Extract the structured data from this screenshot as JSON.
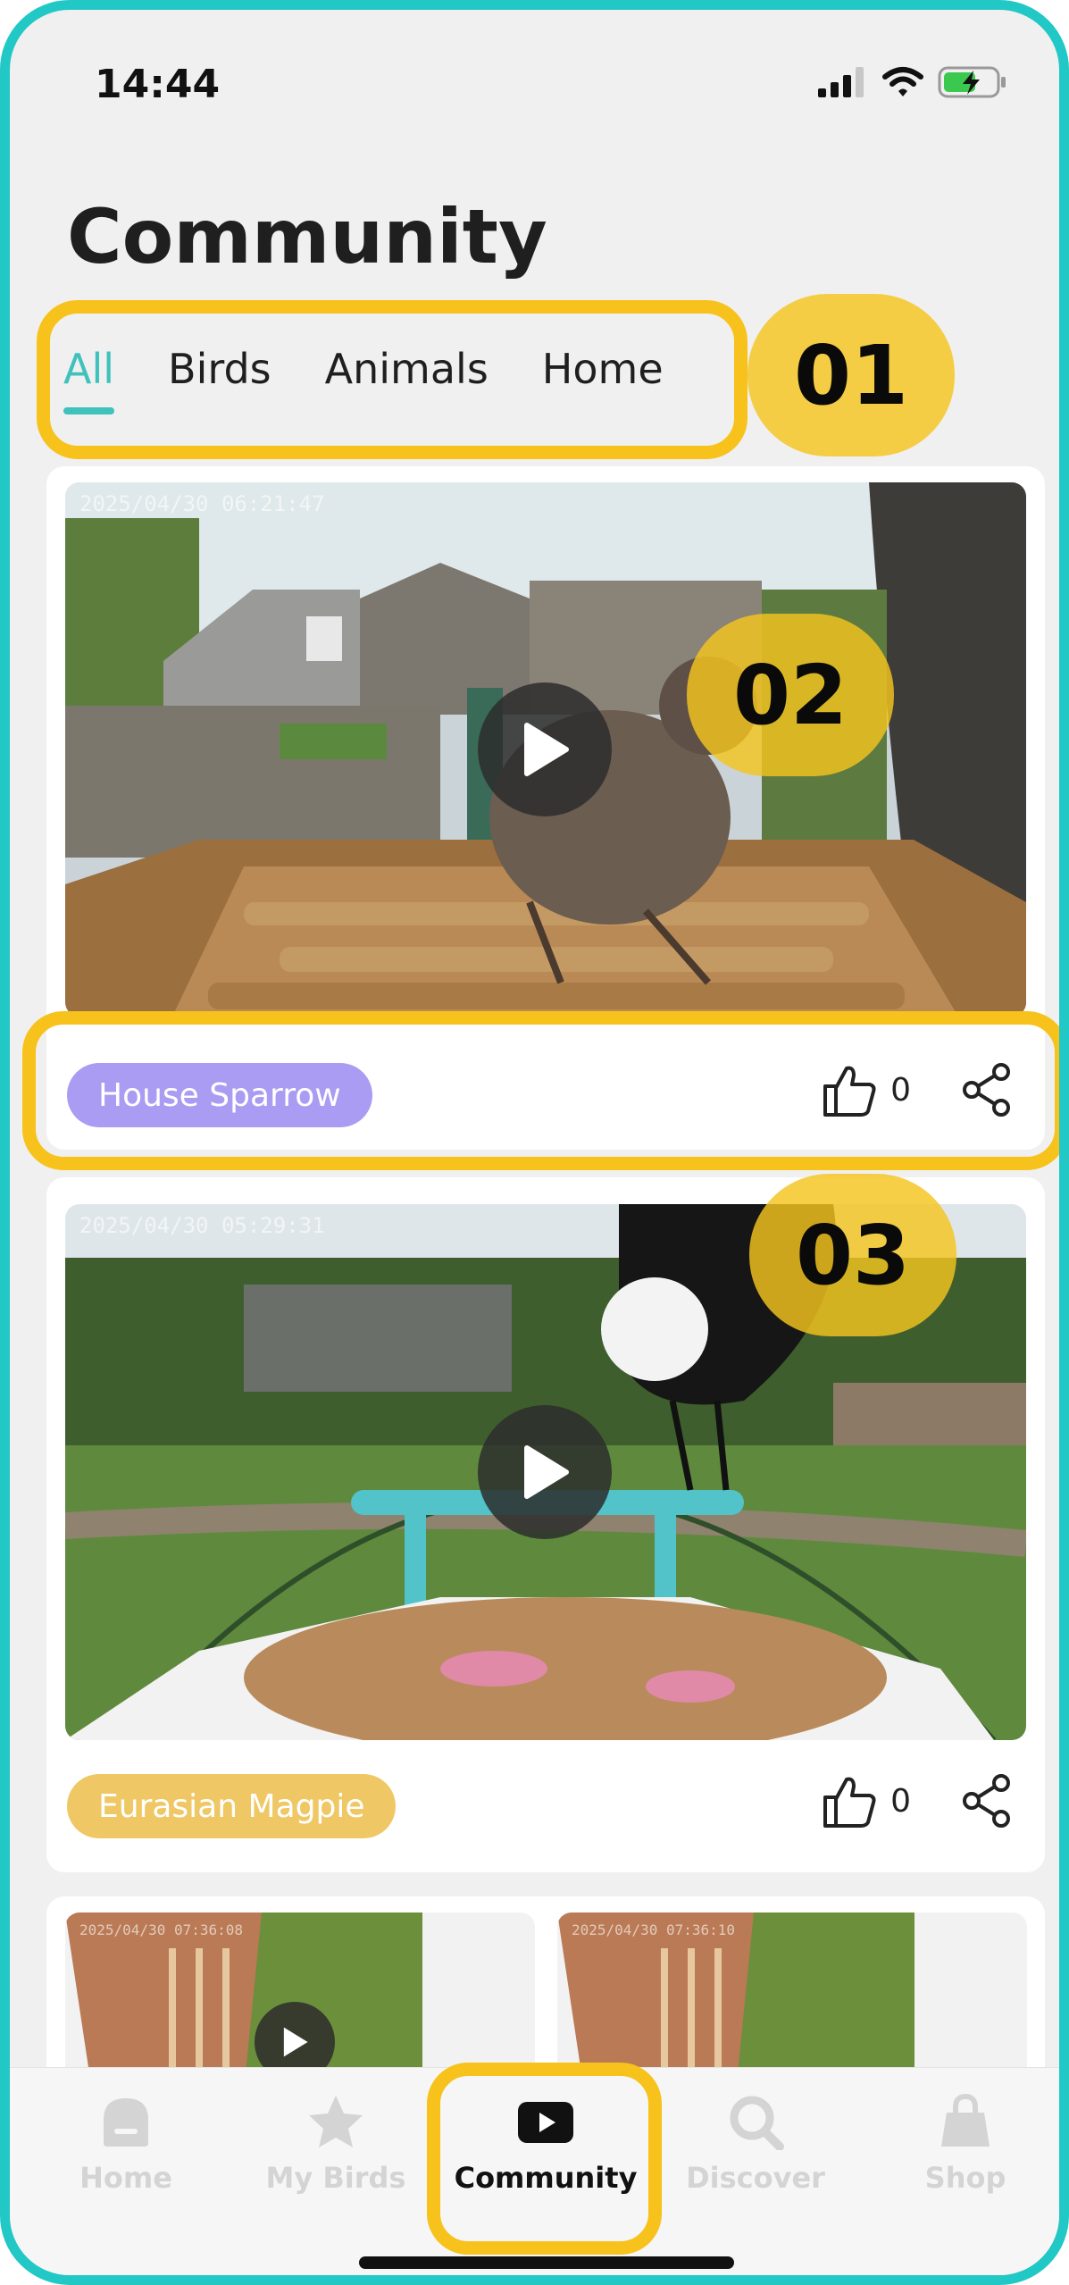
{
  "status_bar": {
    "time": "14:44"
  },
  "page": {
    "title": "Community"
  },
  "tabs": [
    {
      "label": "All",
      "active": true
    },
    {
      "label": "Birds",
      "active": false
    },
    {
      "label": "Animals",
      "active": false
    },
    {
      "label": "Home",
      "active": false
    }
  ],
  "callouts": {
    "tabs": "01",
    "first_video": "02",
    "second_video": "03"
  },
  "posts": [
    {
      "timestamp": "2025/04/30 06:21:47",
      "species": "House Sparrow",
      "species_color": "#a99cf2",
      "likes": "0"
    },
    {
      "timestamp": "2025/04/30 05:29:31",
      "species": "Eurasian Magpie",
      "species_color": "#efc865",
      "likes": "0"
    },
    {
      "timestamps": [
        "2025/04/30 07:36:08",
        "2025/04/30 07:36:10"
      ]
    }
  ],
  "bottom_nav": [
    {
      "label": "Home",
      "icon": "home-icon",
      "active": false
    },
    {
      "label": "My Birds",
      "icon": "star-icon",
      "active": false
    },
    {
      "label": "Community",
      "icon": "play-icon",
      "active": true
    },
    {
      "label": "Discover",
      "icon": "search-icon",
      "active": false
    },
    {
      "label": "Shop",
      "icon": "shopping-bag-icon",
      "active": false
    }
  ],
  "colors": {
    "frame": "#21c8c6",
    "accent": "#3fc1bc",
    "highlight": "#f7c21b"
  }
}
